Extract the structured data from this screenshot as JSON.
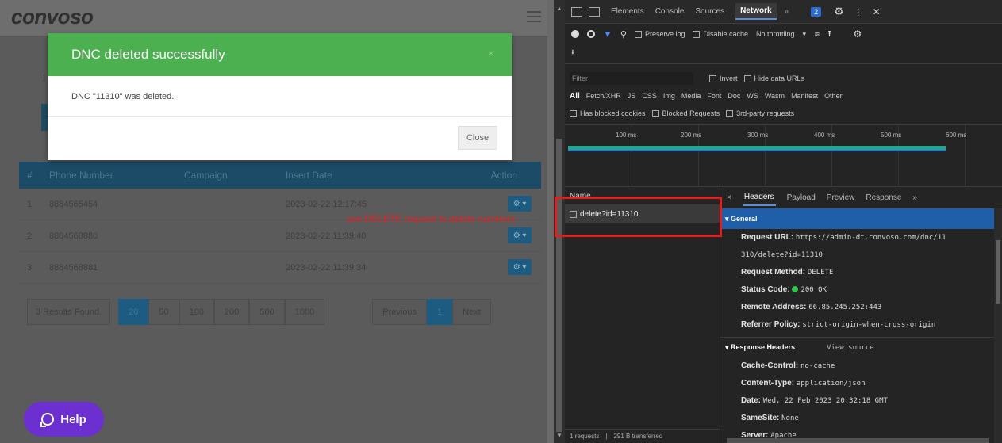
{
  "app": {
    "logo": "convoso",
    "bg_letter": "I",
    "table": {
      "columns": [
        "#",
        "Phone Number",
        "Campaign",
        "Insert Date",
        "Action"
      ],
      "rows": [
        {
          "num": "1",
          "phone": "8884565454",
          "campaign": "",
          "date": "2023-02-22 12:17:45"
        },
        {
          "num": "2",
          "phone": "8884568880",
          "campaign": "",
          "date": "2023-02-22 11:39:40"
        },
        {
          "num": "3",
          "phone": "8884568881",
          "campaign": "",
          "date": "2023-02-22 11:39:34"
        }
      ],
      "action_label": "⚙ ▾"
    },
    "annotation": "use DELETE request to delete numbers",
    "pagination": {
      "results": "3 Results Found.",
      "sizes": [
        "20",
        "50",
        "100",
        "200",
        "500",
        "1000"
      ],
      "active_size": "20",
      "prev": "Previous",
      "page": "1",
      "next": "Next"
    },
    "help": "Help"
  },
  "modal": {
    "title": "DNC deleted successfully",
    "close_x": "×",
    "message": "DNC \"11310\" was deleted.",
    "close_button": "Close"
  },
  "devtools": {
    "tabs": [
      "Elements",
      "Console",
      "Sources",
      "Network"
    ],
    "active_tab": "Network",
    "more": "»",
    "badge": "2",
    "toolbar": {
      "preserve_log": "Preserve log",
      "disable_cache": "Disable cache",
      "throttle": "No throttling"
    },
    "filter": {
      "placeholder": "Filter",
      "invert": "Invert",
      "hide_data": "Hide data URLs",
      "types": [
        "All",
        "Fetch/XHR",
        "JS",
        "CSS",
        "Img",
        "Media",
        "Font",
        "Doc",
        "WS",
        "Wasm",
        "Manifest",
        "Other"
      ],
      "has_blocked": "Has blocked cookies",
      "blocked_req": "Blocked Requests",
      "third_party": "3rd-party requests"
    },
    "timeline": [
      "100 ms",
      "200 ms",
      "300 ms",
      "400 ms",
      "500 ms",
      "600 ms"
    ],
    "names": {
      "header": "Name",
      "request": "delete?id=11310",
      "status_requests": "1 requests",
      "status_transferred": "291 B transferred"
    },
    "details": {
      "close": "×",
      "tabs": [
        "Headers",
        "Payload",
        "Preview",
        "Response"
      ],
      "active_tab": "Headers",
      "more": "»",
      "general_title": "▾ General",
      "general": [
        {
          "k": "Request URL:",
          "v": "https://admin-dt.convoso.com/dnc/11"
        },
        {
          "k": "",
          "v": "310/delete?id=11310"
        },
        {
          "k": "Request Method:",
          "v": "DELETE"
        },
        {
          "k": "Status Code:",
          "v": "200 OK"
        },
        {
          "k": "Remote Address:",
          "v": "66.85.245.252:443"
        },
        {
          "k": "Referrer Policy:",
          "v": "strict-origin-when-cross-origin"
        }
      ],
      "response_title": "▾ Response Headers",
      "view_source": "View source",
      "response": [
        {
          "k": "Cache-Control:",
          "v": "no-cache"
        },
        {
          "k": "Content-Type:",
          "v": "application/json"
        },
        {
          "k": "Date:",
          "v": "Wed, 22 Feb 2023 20:32:18 GMT"
        },
        {
          "k": "SameSite:",
          "v": "None"
        },
        {
          "k": "Server:",
          "v": "Apache"
        }
      ]
    }
  },
  "colors": {
    "modal_green": "#4caf50",
    "help_purple": "#6c2fd0",
    "annotation_red": "#e82020",
    "devtools_blue": "#1f5ea8"
  }
}
